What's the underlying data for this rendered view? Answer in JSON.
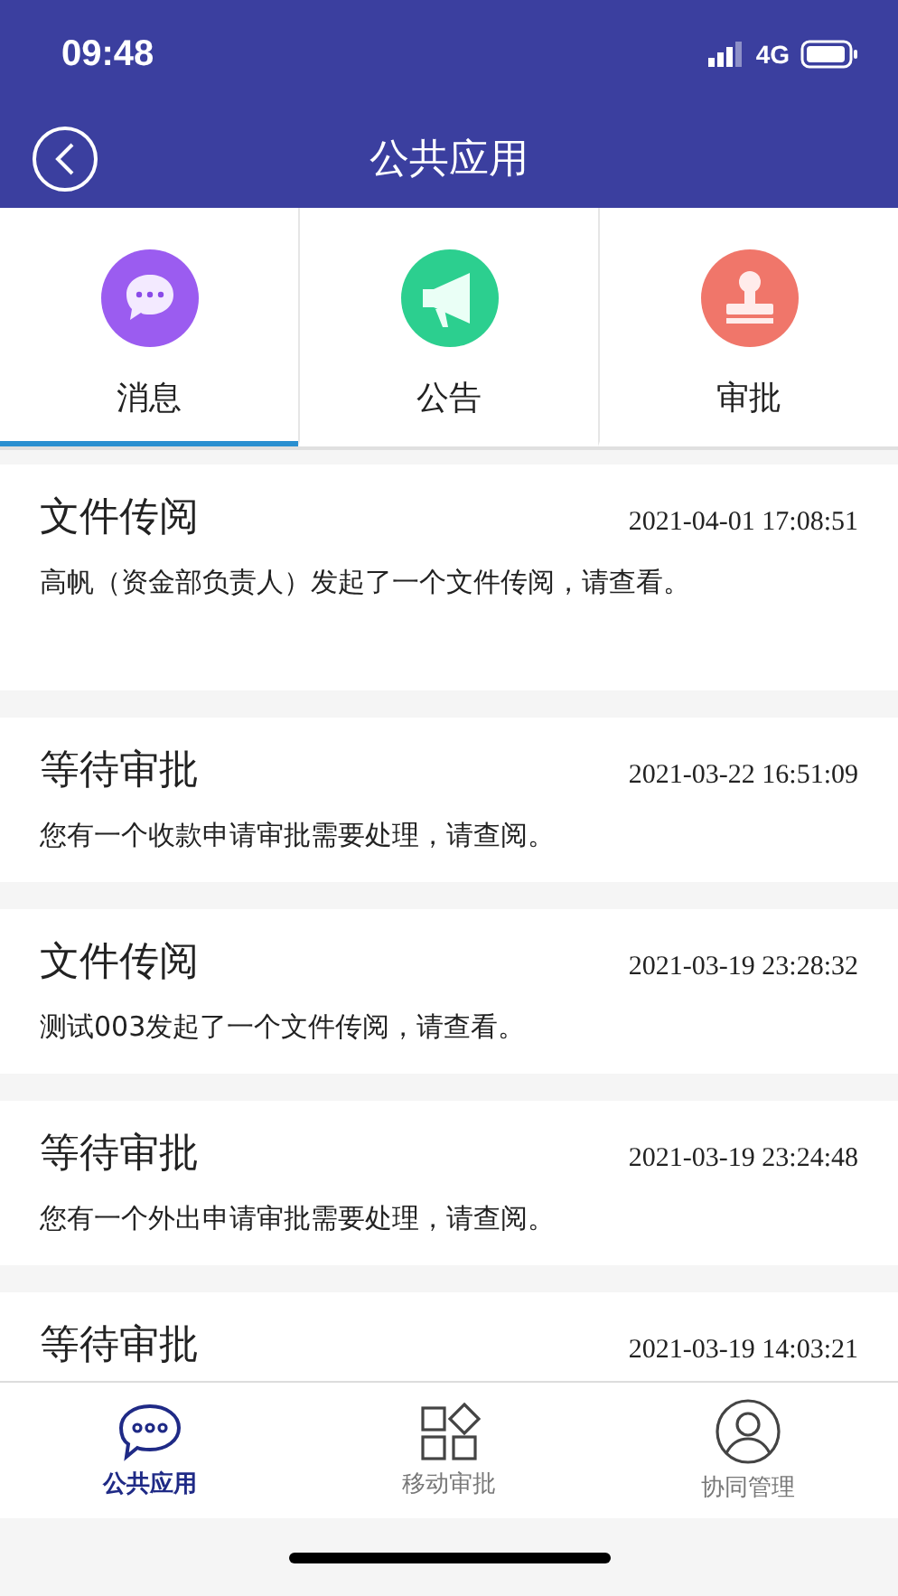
{
  "status_bar": {
    "time": "09:48",
    "network": "4G"
  },
  "header": {
    "title": "公共应用"
  },
  "tabs": [
    {
      "label": "消息",
      "selected": true,
      "kind": "chat"
    },
    {
      "label": "公告",
      "selected": false,
      "kind": "megaphone"
    },
    {
      "label": "审批",
      "selected": false,
      "kind": "stamp"
    }
  ],
  "messages": [
    {
      "title": "文件传阅",
      "time": "2021-04-01 17:08:51",
      "message": "高帆（资金部负责人）发起了一个文件传阅，请查看。",
      "tall": true
    },
    {
      "title": "等待审批",
      "time": "2021-03-22 16:51:09",
      "message": "您有一个收款申请审批需要处理，请查阅。"
    },
    {
      "title": "文件传阅",
      "time": "2021-03-19 23:28:32",
      "message": "测试003发起了一个文件传阅，请查看。"
    },
    {
      "title": "等待审批",
      "time": "2021-03-19 23:24:48",
      "message": "您有一个外出申请审批需要处理，请查阅。"
    },
    {
      "title": "等待审批",
      "time": "2021-03-19 14:03:21"
    }
  ],
  "bottom_nav": [
    {
      "label": "公共应用",
      "selected": true,
      "kind": "chat"
    },
    {
      "label": "移动审批",
      "selected": false,
      "kind": "grid"
    },
    {
      "label": "协同管理",
      "selected": false,
      "kind": "user"
    }
  ]
}
